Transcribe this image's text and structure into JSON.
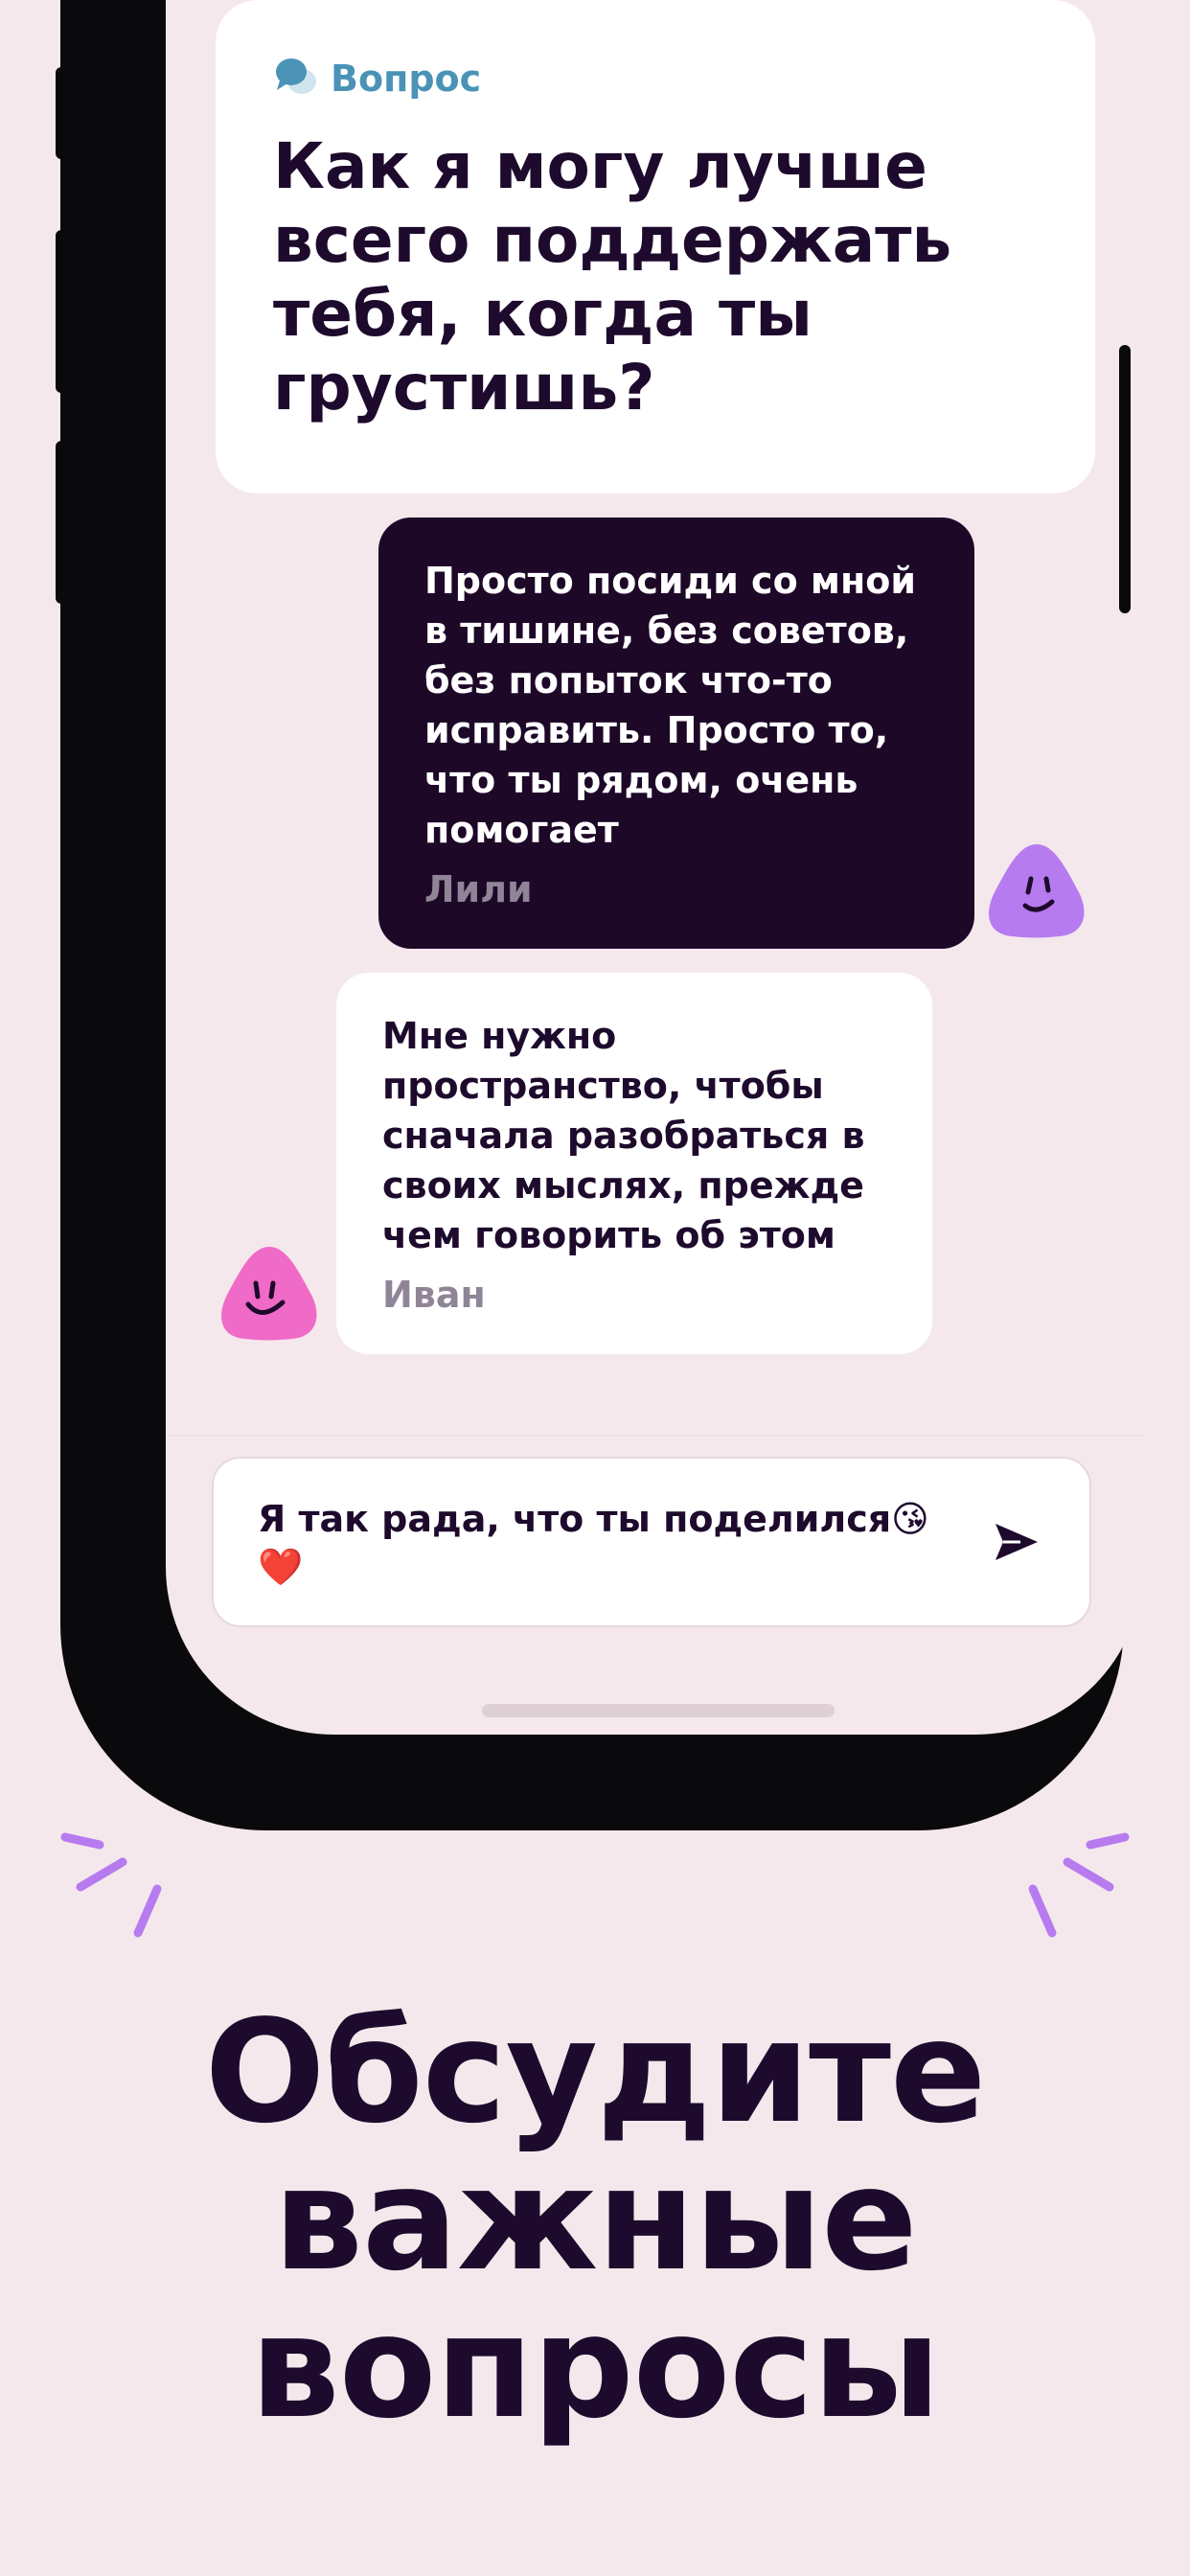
{
  "question_card": {
    "label": "Вопрос",
    "title": "Как я могу лучше всего поддержать тебя, когда ты грустишь?"
  },
  "messages": [
    {
      "text": "Просто посиди со мной в тишине, без советов, без попыток что-то исправить. Просто то, что ты рядом, очень помогает",
      "author": "Лили"
    },
    {
      "text": "Мне нужно пространство, чтобы сначала разобраться в своих мыслях, прежде чем говорить об этом",
      "author": "Иван"
    }
  ],
  "composer": {
    "value": "Я так рада, что ты поделился😘❤️"
  },
  "headline": {
    "line1": "Обсудите",
    "line2": "важные",
    "line3": "вопросы"
  },
  "colors": {
    "background": "#f5e8ec",
    "dark_bubble": "#1e0828",
    "accent_blue": "#4a93b7",
    "avatar_purple": "#b77bf0",
    "avatar_pink": "#f06ac8",
    "spark_purple": "#b77bf0"
  },
  "icons": {
    "question": "speech-bubbles-icon",
    "send": "send-arrow-icon"
  }
}
